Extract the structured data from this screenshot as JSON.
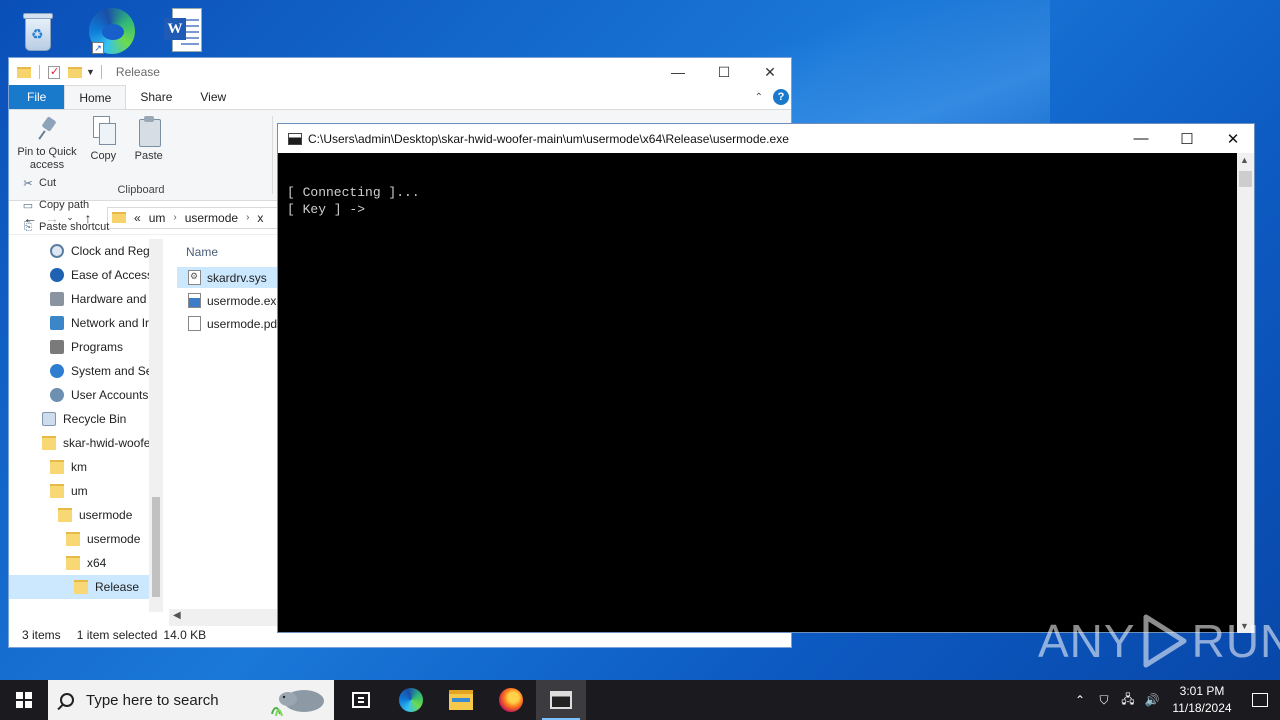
{
  "desktop": {
    "icons": [
      "recycle-bin",
      "microsoft-edge",
      "word-document"
    ]
  },
  "explorer": {
    "title": "Release",
    "tabs": {
      "file": "File",
      "home": "Home",
      "share": "Share",
      "view": "View"
    },
    "clipboard": {
      "pin": "Pin to Quick access",
      "copy": "Copy",
      "paste": "Paste",
      "cut": "Cut",
      "copy_path": "Copy path",
      "paste_shortcut": "Paste shortcut",
      "group_label": "Clipboard"
    },
    "address": {
      "overflow": "«",
      "crumbs": [
        "um",
        "usermode",
        "x"
      ]
    },
    "nav_items": [
      {
        "label": "Clock and Regi",
        "icon": "clock-region-icon"
      },
      {
        "label": "Ease of Access",
        "icon": "ease-of-access-icon"
      },
      {
        "label": "Hardware and",
        "icon": "hardware-icon"
      },
      {
        "label": "Network and Ir",
        "icon": "network-icon"
      },
      {
        "label": "Programs",
        "icon": "programs-icon"
      },
      {
        "label": "System and Se",
        "icon": "system-security-icon"
      },
      {
        "label": "User Accounts",
        "icon": "user-accounts-icon"
      },
      {
        "label": "Recycle Bin",
        "icon": "recycle-bin-icon"
      },
      {
        "label": "skar-hwid-woofe",
        "icon": "folder-icon"
      },
      {
        "label": "km",
        "icon": "folder-icon"
      },
      {
        "label": "um",
        "icon": "folder-icon"
      },
      {
        "label": "usermode",
        "icon": "folder-icon"
      },
      {
        "label": "usermode",
        "icon": "folder-icon"
      },
      {
        "label": "x64",
        "icon": "folder-icon"
      },
      {
        "label": "Release",
        "icon": "folder-icon"
      }
    ],
    "column_header": "Name",
    "files": [
      {
        "name": "skardrv.sys",
        "type": "sys",
        "selected": true
      },
      {
        "name": "usermode.exe",
        "type": "exe",
        "selected": false
      },
      {
        "name": "usermode.pdb",
        "type": "pdb",
        "selected": false
      }
    ],
    "status": {
      "items": "3 items",
      "selected": "1 item selected",
      "size": "14.0 KB"
    }
  },
  "console": {
    "title": "C:\\Users\\admin\\Desktop\\skar-hwid-woofer-main\\um\\usermode\\x64\\Release\\usermode.exe",
    "lines": [
      "[ Connecting ]...",
      "[ Key ] ->"
    ]
  },
  "watermark": {
    "left": "ANY",
    "right": "RUN"
  },
  "taskbar": {
    "search_placeholder": "Type here to search",
    "apps": [
      "task-view",
      "edge",
      "file-explorer",
      "firefox",
      "console"
    ],
    "clock_time": "3:01 PM",
    "clock_date": "11/18/2024"
  },
  "colors": {
    "accent": "#1979ca",
    "selection": "#cce8ff",
    "taskbar": "#1b1b1f",
    "console_bg": "#000000",
    "console_text": "#cfcfcf"
  }
}
